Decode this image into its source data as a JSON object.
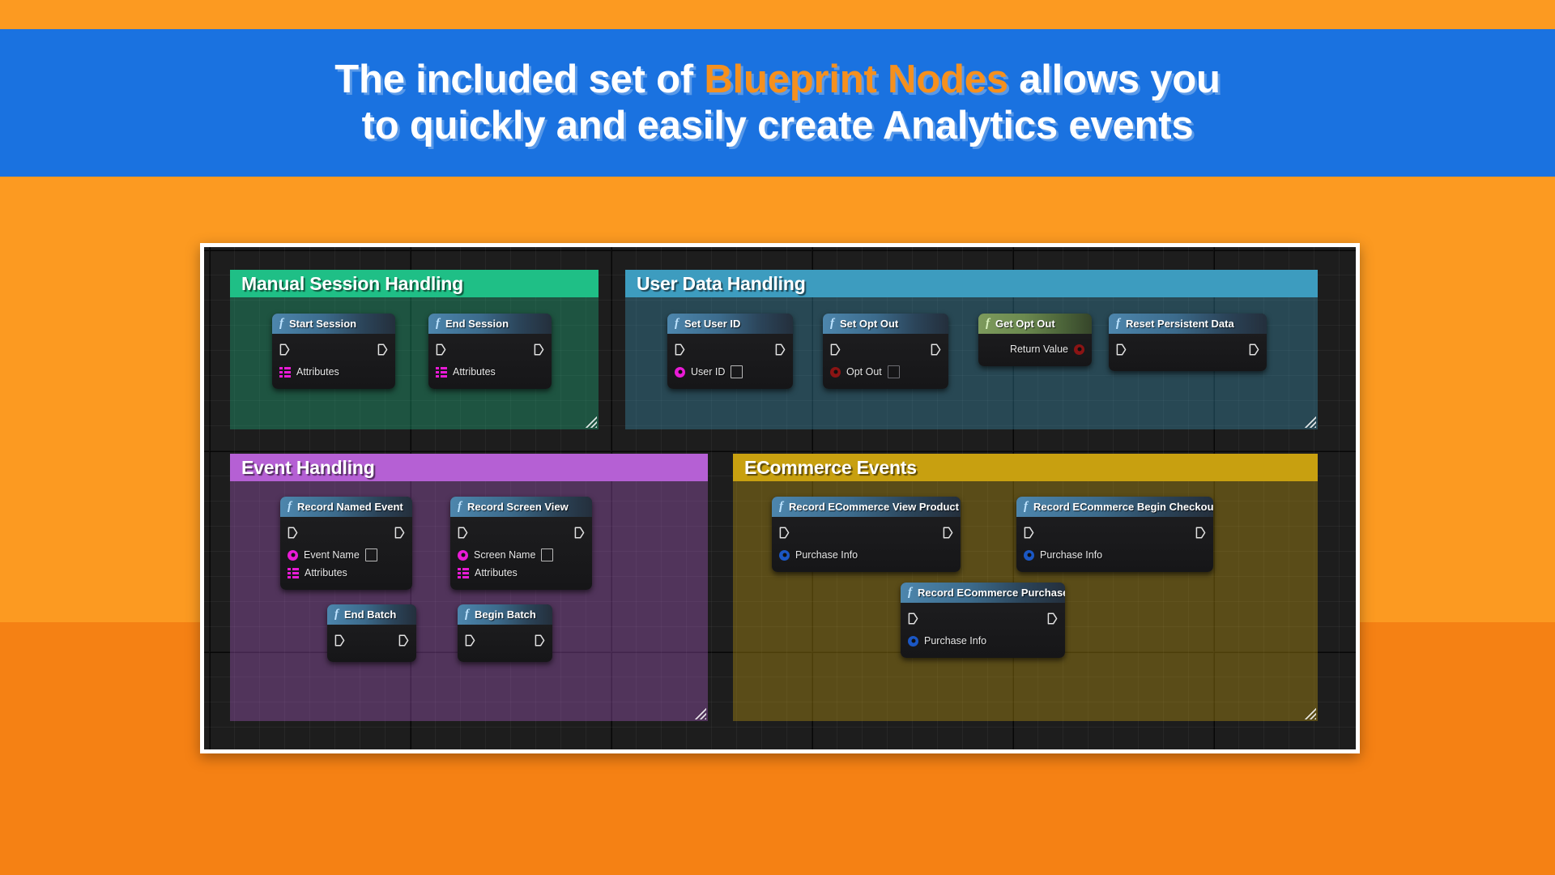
{
  "banner": {
    "line1_pre": "The included set of ",
    "line1_accent": "Blueprint Nodes",
    "line1_post": " allows you",
    "line2": "to quickly and easily create Analytics events",
    "bg_color": "#1A72E0",
    "accent_color": "#F5901E"
  },
  "page": {
    "bg_color": "#FC9A21",
    "bg_lower_color": "#F58114"
  },
  "graph": {
    "canvas_color": "#1d1d1d",
    "frame_color": "#FFFFFF",
    "comments": [
      {
        "title": "Manual Session Handling",
        "color": "#1FBF86",
        "body_color": "rgba(31,191,134,0.34)",
        "nodes": [
          {
            "title": "Start Session",
            "icon": "function-f-icon",
            "pure": false,
            "exec_in": true,
            "exec_out": true,
            "pins": [
              {
                "label": "Attributes",
                "pin": "array-pin",
                "color": "#E91BD6",
                "value_box": "none"
              }
            ]
          },
          {
            "title": "End Session",
            "icon": "function-f-icon",
            "pure": false,
            "exec_in": true,
            "exec_out": true,
            "pins": [
              {
                "label": "Attributes",
                "pin": "array-pin",
                "color": "#E91BD6",
                "value_box": "none"
              }
            ]
          }
        ]
      },
      {
        "title": "User Data Handling",
        "color": "#3D9CBF",
        "body_color": "rgba(61,156,191,0.34)",
        "nodes": [
          {
            "title": "Set User ID",
            "icon": "function-f-icon",
            "pure": false,
            "exec_in": true,
            "exec_out": true,
            "pins": [
              {
                "label": "User ID",
                "pin": "circle-pin",
                "color": "#E91BD6",
                "value_box": "light"
              }
            ]
          },
          {
            "title": "Set Opt Out",
            "icon": "function-f-icon",
            "pure": false,
            "exec_in": true,
            "exec_out": true,
            "pins": [
              {
                "label": "Opt Out",
                "pin": "circle-pin",
                "color": "#8B1414",
                "value_box": "dark"
              }
            ]
          },
          {
            "title": "Get Opt Out",
            "icon": "function-f-icon",
            "pure": true,
            "exec_in": false,
            "exec_out": false,
            "pins": [
              {
                "label": "Return Value",
                "pin": "circle-pin",
                "color": "#8B1414",
                "value_box": "none",
                "align": "right"
              }
            ]
          },
          {
            "title": "Reset Persistent Data",
            "icon": "function-f-icon",
            "pure": false,
            "exec_in": true,
            "exec_out": true,
            "pins": []
          }
        ]
      },
      {
        "title": "Event Handling",
        "color": "#B560D4",
        "body_color": "rgba(181,96,212,0.34)",
        "nodes": [
          {
            "title": "Record Named Event",
            "icon": "function-f-icon",
            "pure": false,
            "exec_in": true,
            "exec_out": true,
            "pins": [
              {
                "label": "Event Name",
                "pin": "circle-pin",
                "color": "#E91BD6",
                "value_box": "light"
              },
              {
                "label": "Attributes",
                "pin": "array-pin",
                "color": "#E91BD6",
                "value_box": "none"
              }
            ]
          },
          {
            "title": "Record Screen View",
            "icon": "function-f-icon",
            "pure": false,
            "exec_in": true,
            "exec_out": true,
            "pins": [
              {
                "label": "Screen Name",
                "pin": "circle-pin",
                "color": "#E91BD6",
                "value_box": "light"
              },
              {
                "label": "Attributes",
                "pin": "array-pin",
                "color": "#E91BD6",
                "value_box": "none"
              }
            ]
          },
          {
            "title": "End Batch",
            "icon": "function-f-icon",
            "pure": false,
            "exec_in": true,
            "exec_out": true,
            "pins": []
          },
          {
            "title": "Begin Batch",
            "icon": "function-f-icon",
            "pure": false,
            "exec_in": true,
            "exec_out": true,
            "pins": []
          }
        ]
      },
      {
        "title": "ECommerce Events",
        "color": "#C8A010",
        "body_color": "rgba(200,160,16,0.36)",
        "nodes": [
          {
            "title": "Record ECommerce View Product",
            "icon": "function-f-icon",
            "pure": false,
            "exec_in": true,
            "exec_out": true,
            "pins": [
              {
                "label": "Purchase Info",
                "pin": "circle-pin",
                "color": "#1B57C4",
                "value_box": "none"
              }
            ]
          },
          {
            "title": "Record ECommerce Begin Checkout",
            "icon": "function-f-icon",
            "pure": false,
            "exec_in": true,
            "exec_out": true,
            "pins": [
              {
                "label": "Purchase Info",
                "pin": "circle-pin",
                "color": "#1B57C4",
                "value_box": "none"
              }
            ]
          },
          {
            "title": "Record ECommerce Purchase",
            "icon": "function-f-icon",
            "pure": false,
            "exec_in": true,
            "exec_out": true,
            "pins": [
              {
                "label": "Purchase Info",
                "pin": "circle-pin",
                "color": "#1B57C4",
                "value_box": "none"
              }
            ]
          }
        ]
      }
    ]
  }
}
